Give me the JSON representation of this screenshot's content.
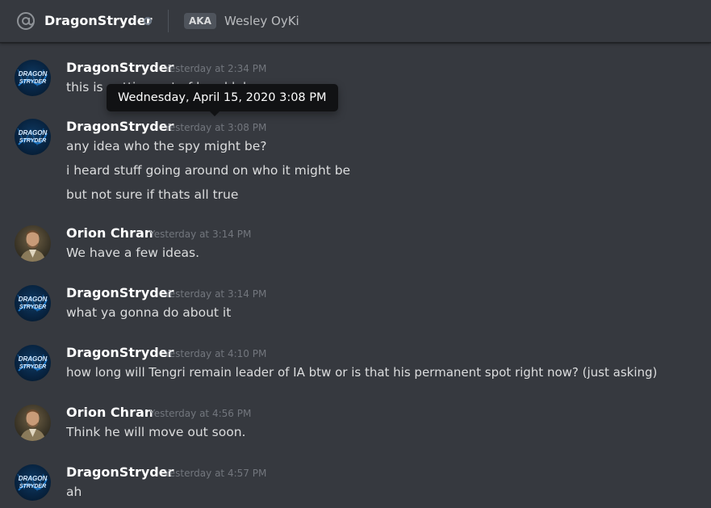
{
  "header": {
    "channel_name": "DragonStryder",
    "aka_label": "AKA",
    "aka_name": "Wesley OyKi"
  },
  "tooltip": {
    "text": "Wednesday, April 15, 2020 3:08 PM"
  },
  "messages": [
    {
      "author": "DragonStryder",
      "timestamp": "Yesterday at 2:34 PM",
      "avatar": "DRAGON STRYDER logo",
      "lines": [
        "this is getting out of hand lol"
      ]
    },
    {
      "author": "DragonStryder",
      "timestamp": "Yesterday at 3:08 PM",
      "avatar": "DRAGON STRYDER logo",
      "lines": [
        "any idea who the spy might be?",
        "i heard stuff going around on who it might be",
        "but not sure if thats all true"
      ]
    },
    {
      "author": "Orion Chran",
      "timestamp": "Yesterday at 3:14 PM",
      "avatar": "portrait",
      "lines": [
        "We have a few ideas."
      ]
    },
    {
      "author": "DragonStryder",
      "timestamp": "Yesterday at 3:14 PM",
      "avatar": "DRAGON STRYDER logo",
      "lines": [
        "what ya gonna do about it"
      ]
    },
    {
      "author": "DragonStryder",
      "timestamp": "Yesterday at 4:10 PM",
      "avatar": "DRAGON STRYDER logo",
      "lines": [
        "how long will Tengri remain leader of IA btw or is that his permanent spot right now? (just asking)"
      ]
    },
    {
      "author": "Orion Chran",
      "timestamp": "Yesterday at 4:56 PM",
      "avatar": "portrait",
      "lines": [
        "Think he will move out soon."
      ]
    },
    {
      "author": "DragonStryder",
      "timestamp": "Yesterday at 4:57 PM",
      "avatar": "DRAGON STRYDER logo",
      "lines": [
        "ah"
      ]
    }
  ],
  "colors": {
    "background": "#36393f",
    "author": "#ffffff",
    "timestamp": "#72767d",
    "text": "#dcddde",
    "tooltip_bg": "#111214"
  }
}
